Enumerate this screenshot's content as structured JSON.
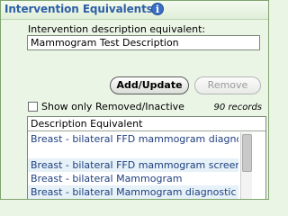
{
  "section": {
    "title": "Intervention Equivalents",
    "info_icon": "info-icon"
  },
  "description_field": {
    "label": "Intervention description equivalent:",
    "value": "Mammogram Test Description"
  },
  "buttons": {
    "add_update": "Add/Update",
    "remove": "Remove"
  },
  "filter": {
    "checkbox_label": "Show only Removed/Inactive",
    "checked": false,
    "record_count": "90 records"
  },
  "list": {
    "column_header": "Description Equivalent",
    "rows": [
      "Breast - bilateral FFD mammogram diagnostic",
      "Breast - bilateral FFD mammogram screening",
      "Breast - bilateral Mammogram",
      "Breast - bilateral Mammogram diagnostic"
    ]
  },
  "colors": {
    "title": "#2e5fa6",
    "background": "#ebf5e6",
    "row_text": "#1f3f7f",
    "row_alt": "#e6f1f8"
  }
}
